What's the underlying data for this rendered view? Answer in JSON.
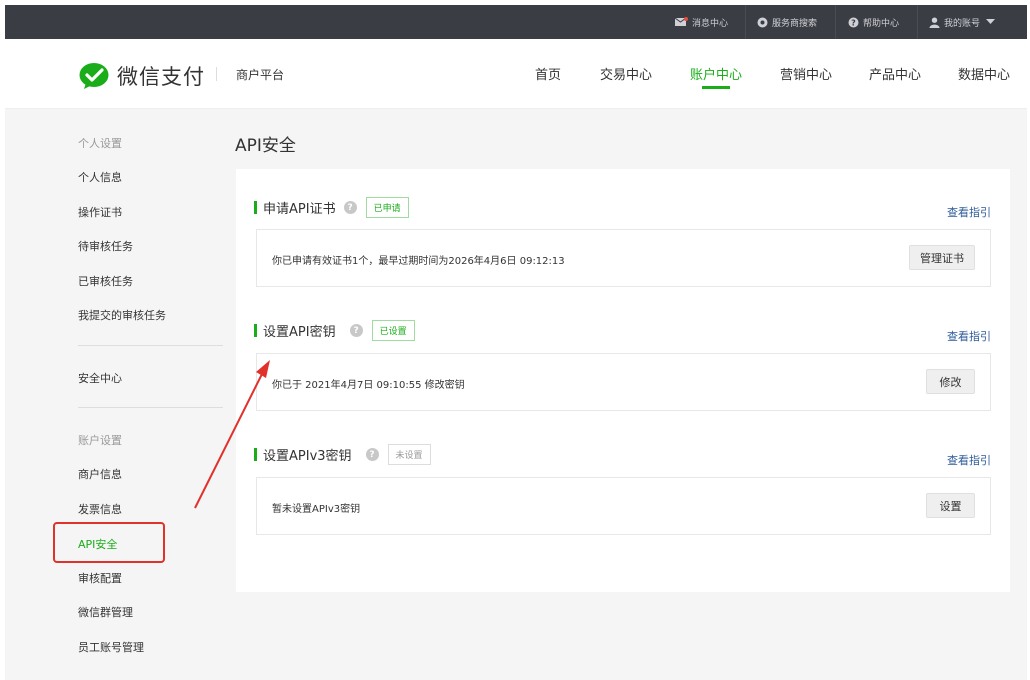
{
  "topbar": {
    "messages": "消息中心",
    "service_search": "服务商搜索",
    "help_center": "帮助中心",
    "my_account": "我的账号"
  },
  "header": {
    "logo_text": "微信支付",
    "subtitle": "商户平台",
    "nav": [
      "首页",
      "交易中心",
      "账户中心",
      "营销中心",
      "产品中心",
      "数据中心"
    ],
    "active_nav": "账户中心"
  },
  "sidebar": {
    "personal_heading": "个人设置",
    "personal_items": [
      "个人信息",
      "操作证书",
      "待审核任务",
      "已审核任务",
      "我提交的审核任务"
    ],
    "security_center": "安全中心",
    "account_heading": "账户设置",
    "account_items": [
      "商户信息",
      "发票信息",
      "API安全",
      "审核配置",
      "微信群管理",
      "员工账号管理"
    ]
  },
  "main": {
    "title": "API安全",
    "sections": [
      {
        "title": "申请API证书",
        "status": "已申请",
        "guide": "查看指引",
        "text": "你已申请有效证书1个，最早过期时间为2026年4月6日 09:12:13",
        "button": "管理证书"
      },
      {
        "title": "设置API密钥",
        "status": "已设置",
        "guide": "查看指引",
        "text": "你已于 2021年4月7日 09:10:55 修改密钥",
        "button": "修改"
      },
      {
        "title": "设置APIv3密钥",
        "status": "未设置",
        "guide": "查看指引",
        "text": "暂未设置APIv3密钥",
        "button": "设置"
      }
    ]
  },
  "colors": {
    "accent": "#1aad19",
    "topbar": "#3b3d44",
    "link": "#2e5b9a",
    "annotation": "#e0322b"
  }
}
